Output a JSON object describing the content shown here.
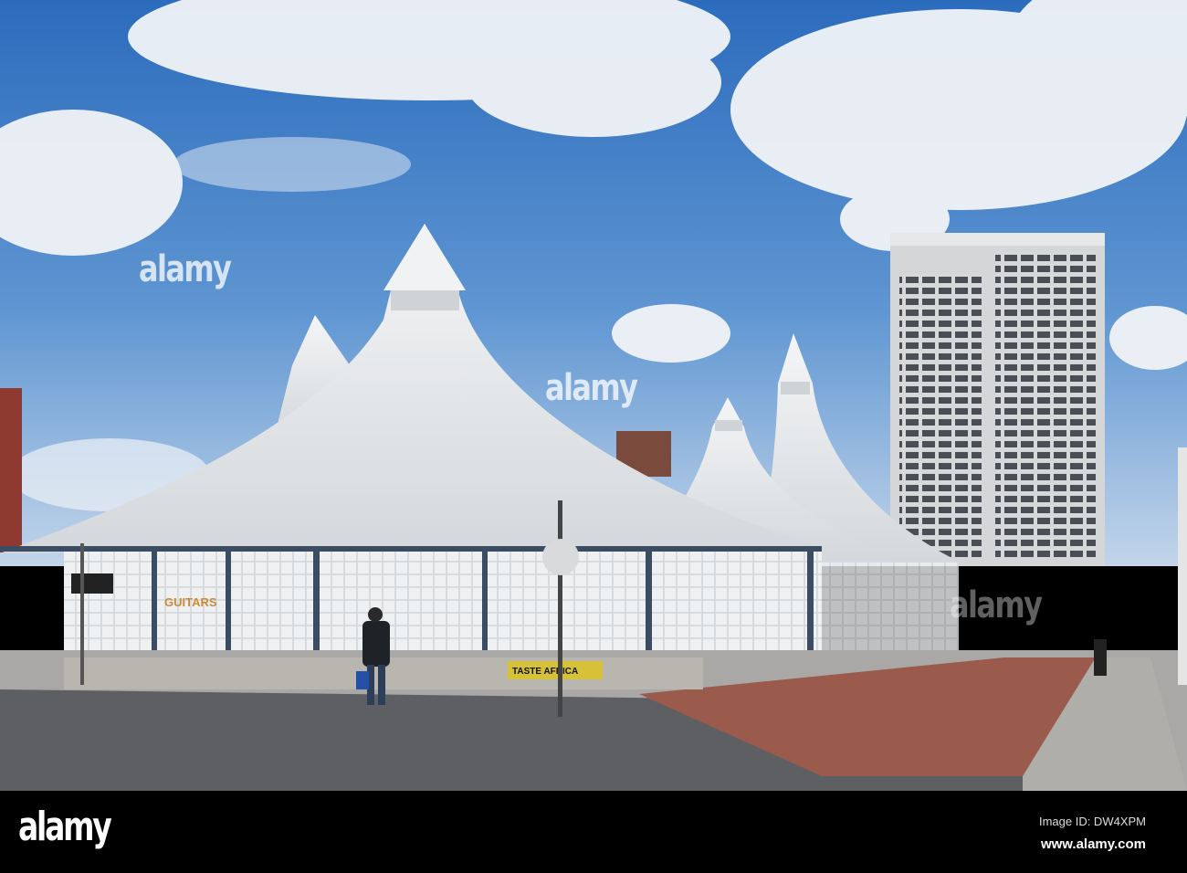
{
  "watermark": "alamy",
  "shop_signs": {
    "guitars": "GUITARS",
    "taste_africa": "TASTE AFRICA"
  },
  "footer": {
    "logo": "alamy",
    "image_id": "Image ID: DW4XPM",
    "website": "www.alamy.com"
  },
  "colors": {
    "sky_top": "#2f6fbf",
    "sky_bottom": "#b7cde6",
    "tent": "#e9ecef",
    "brick": "#9a5a4c",
    "bar": "#000000"
  }
}
